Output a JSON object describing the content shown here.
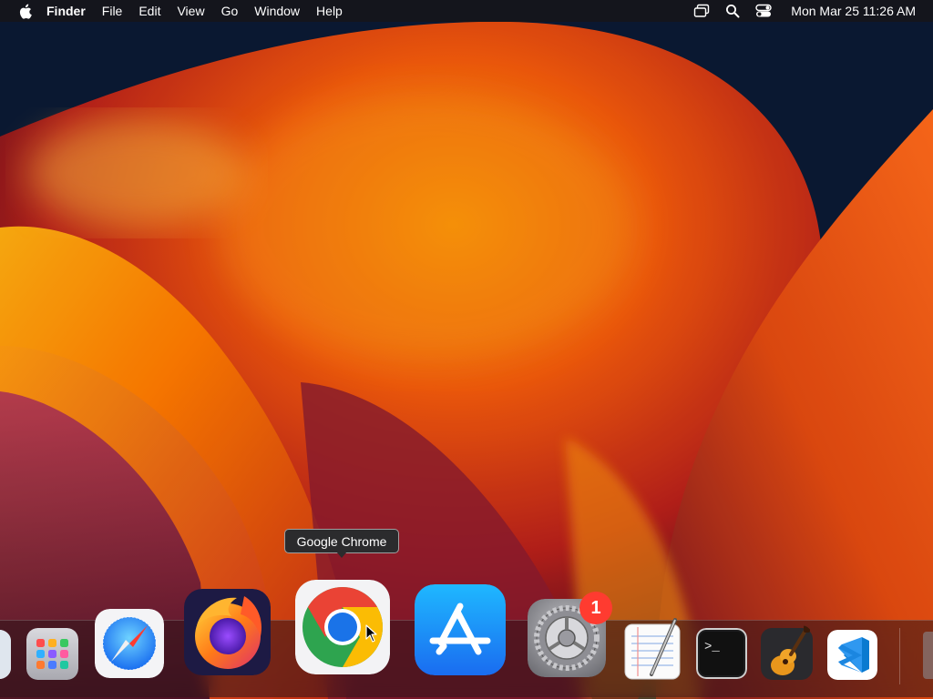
{
  "menubar": {
    "app_name": "Finder",
    "menus": [
      "File",
      "Edit",
      "View",
      "Go",
      "Window",
      "Help"
    ],
    "status_icons": [
      "screen-mirroring-icon",
      "spotlight-search-icon",
      "control-center-icon"
    ],
    "clock": "Mon Mar 25  11:26 AM"
  },
  "dock": {
    "hovered_app": "Google Chrome",
    "items": [
      {
        "name": "finder",
        "icon": "finder-icon"
      },
      {
        "name": "launchpad",
        "icon": "launchpad-icon"
      },
      {
        "name": "safari",
        "icon": "safari-icon"
      },
      {
        "name": "firefox",
        "icon": "firefox-icon"
      },
      {
        "name": "google-chrome",
        "icon": "chrome-icon"
      },
      {
        "name": "app-store",
        "icon": "app-store-icon"
      },
      {
        "name": "system-preferences",
        "icon": "system-preferences-icon",
        "badge": "1"
      },
      {
        "name": "textedit",
        "icon": "textedit-icon"
      },
      {
        "name": "terminal",
        "icon": "terminal-icon"
      },
      {
        "name": "garageband",
        "icon": "garageband-icon"
      },
      {
        "name": "vscode",
        "icon": "vscode-icon"
      },
      {
        "name": "trash",
        "icon": "trash-icon"
      }
    ]
  },
  "tooltip": {
    "label": "Google Chrome"
  },
  "terminal_prompt": ">_",
  "colors": {
    "wallpaper_dark": "#0a1a33",
    "wallpaper_orange": "#ff8a00",
    "wallpaper_red": "#d0281a",
    "badge": "#ff3b30",
    "menubar": "#16161a"
  }
}
